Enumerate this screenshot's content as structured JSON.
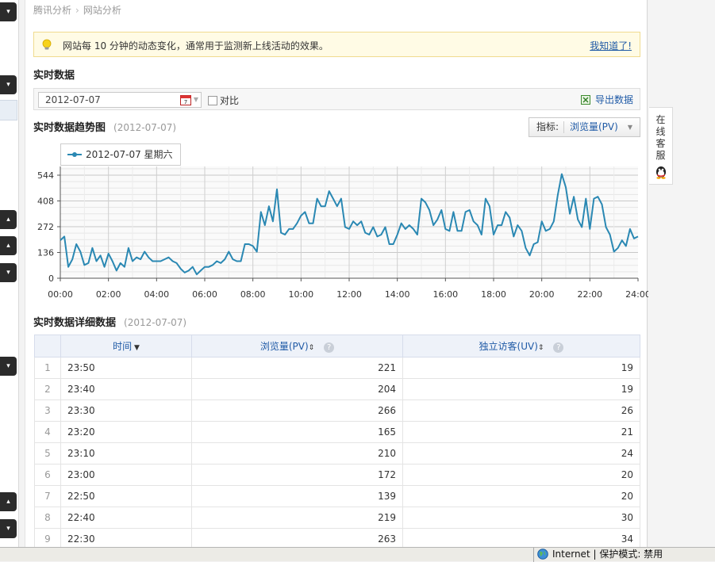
{
  "breadcrumb": {
    "parent": "腾讯分析",
    "current": "网站分析"
  },
  "notice": {
    "text": "网站每 10 分钟的动态变化，通常用于监测新上线活动的效果。",
    "ack": "我知道了!"
  },
  "realtime": {
    "title": "实时数据",
    "date_value": "2012-07-07",
    "compare_label": "对比",
    "export_label": "导出数据"
  },
  "trend": {
    "title": "实时数据趋势图",
    "date": "(2012-07-07)",
    "metric_label": "指标:",
    "metric_value": "浏览量(PV)",
    "legend": "2012-07-07 星期六"
  },
  "detail": {
    "title": "实时数据详细数据",
    "date": "(2012-07-07)",
    "columns": {
      "time": "时间",
      "pv": "浏览量(PV)",
      "uv": "独立访客(UV)"
    },
    "rows": [
      {
        "idx": "1",
        "time": "23:50",
        "pv": "221",
        "uv": "19"
      },
      {
        "idx": "2",
        "time": "23:40",
        "pv": "204",
        "uv": "19"
      },
      {
        "idx": "3",
        "time": "23:30",
        "pv": "266",
        "uv": "26"
      },
      {
        "idx": "4",
        "time": "23:20",
        "pv": "165",
        "uv": "21"
      },
      {
        "idx": "5",
        "time": "23:10",
        "pv": "210",
        "uv": "24"
      },
      {
        "idx": "6",
        "time": "23:00",
        "pv": "172",
        "uv": "20"
      },
      {
        "idx": "7",
        "time": "22:50",
        "pv": "139",
        "uv": "20"
      },
      {
        "idx": "8",
        "time": "22:40",
        "pv": "219",
        "uv": "30"
      },
      {
        "idx": "9",
        "time": "22:30",
        "pv": "263",
        "uv": "34"
      }
    ]
  },
  "service": {
    "label": "在线客服"
  },
  "statusbar": {
    "zone": "Internet | 保护模式: 禁用"
  },
  "colors": {
    "series": "#2a88b3",
    "link": "#1f5aa6",
    "notice_bg": "#fffbe5"
  },
  "icons": [
    "lightbulb-icon",
    "calendar-icon",
    "excel-icon",
    "qq-penguin-icon",
    "help-icon",
    "globe-icon",
    "sort-icon"
  ],
  "chart_data": {
    "type": "line",
    "title": "实时数据趋势图",
    "xlabel": "",
    "ylabel": "",
    "x_ticks": [
      "00:00",
      "02:00",
      "04:00",
      "06:00",
      "08:00",
      "10:00",
      "12:00",
      "14:00",
      "16:00",
      "18:00",
      "20:00",
      "22:00",
      "24:00"
    ],
    "y_ticks": [
      0,
      136,
      272,
      408,
      544
    ],
    "xlim": [
      0,
      24
    ],
    "ylim": [
      0,
      590
    ],
    "grid": true,
    "legend": "top-left",
    "series": [
      {
        "name": "2012-07-07 星期六",
        "interval_minutes": 10,
        "values": [
          200,
          220,
          60,
          100,
          180,
          140,
          70,
          80,
          160,
          90,
          120,
          60,
          130,
          90,
          40,
          80,
          60,
          160,
          90,
          110,
          100,
          140,
          110,
          90,
          90,
          90,
          100,
          110,
          90,
          80,
          50,
          30,
          40,
          60,
          20,
          40,
          60,
          60,
          70,
          90,
          80,
          100,
          140,
          100,
          90,
          90,
          180,
          180,
          170,
          140,
          350,
          280,
          380,
          300,
          470,
          240,
          230,
          260,
          260,
          290,
          330,
          350,
          290,
          290,
          420,
          380,
          380,
          460,
          420,
          380,
          420,
          270,
          260,
          300,
          280,
          300,
          240,
          230,
          270,
          220,
          230,
          270,
          180,
          180,
          230,
          290,
          260,
          280,
          260,
          230,
          420,
          400,
          360,
          280,
          310,
          360,
          260,
          250,
          350,
          250,
          250,
          350,
          360,
          300,
          280,
          230,
          420,
          380,
          230,
          280,
          280,
          350,
          320,
          220,
          280,
          250,
          160,
          120,
          180,
          190,
          300,
          250,
          260,
          300,
          440,
          550,
          480,
          340,
          430,
          310,
          270,
          420,
          260,
          420,
          430,
          390,
          270,
          230,
          140,
          160,
          200,
          170,
          260,
          210,
          220
        ]
      }
    ]
  }
}
